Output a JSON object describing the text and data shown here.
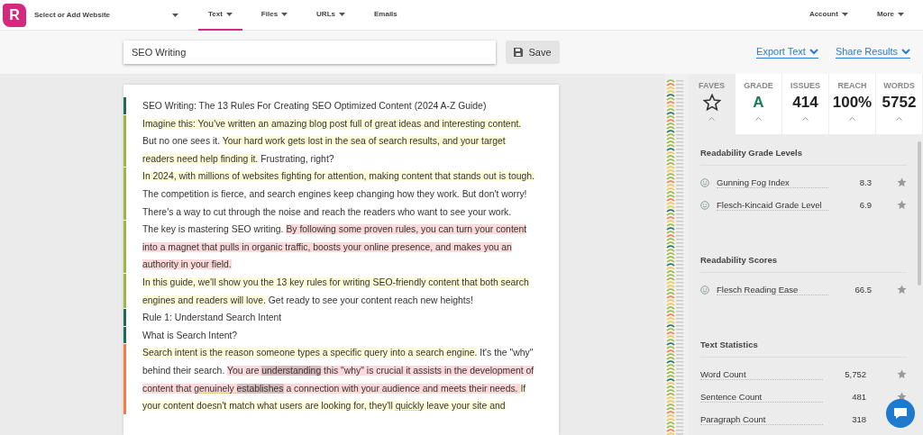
{
  "nav": {
    "site_select": "Select or Add Website",
    "items": [
      {
        "label": "Text",
        "selected": true,
        "dropdown": true
      },
      {
        "label": "Files",
        "selected": false,
        "dropdown": true
      },
      {
        "label": "URLs",
        "selected": false,
        "dropdown": true
      },
      {
        "label": "Emails",
        "selected": false,
        "dropdown": false
      }
    ],
    "right_items": [
      {
        "label": "Account"
      },
      {
        "label": "More"
      }
    ],
    "logo": "R"
  },
  "toolbar": {
    "title_value": "SEO Writing",
    "save": "Save",
    "links": [
      "Export Text",
      "Share Results"
    ]
  },
  "document": {
    "paragraphs": [
      {
        "color": "#1e6b5c",
        "segments": [
          {
            "text": "SEO Writing: The 13 Rules For Creating SEO Optimized Content (2024 A-Z Guide)",
            "hard": false,
            "very_hard": false
          }
        ]
      },
      {
        "color": "#9db83e",
        "segments": [
          {
            "text": "Imagine this: You've written an amazing blog post full of great ideas and interesting content.",
            "hard": true,
            "very_hard": false
          },
          {
            "text": " But no one sees it. ",
            "hard": false,
            "very_hard": false
          },
          {
            "text": "Your hard work gets lost in the sea of search results, and your target readers need help finding it.",
            "hard": true,
            "very_hard": false
          },
          {
            "text": " Frustrating, right?",
            "hard": false,
            "very_hard": false
          }
        ]
      },
      {
        "color": "#9db83e",
        "segments": [
          {
            "text": "In 2024, with millions of websites fighting for attention, making content that stands out is tough.",
            "hard": true,
            "very_hard": false
          },
          {
            "text": " The competition is fierce, and search engines keep changing how they work. But don't worry! There's a way to cut through the noise and reach the readers who want to see your work.",
            "hard": false,
            "very_hard": false
          }
        ]
      },
      {
        "color": "#9db83e",
        "segments": [
          {
            "text": "The key is mastering SEO writing. ",
            "hard": false,
            "very_hard": false
          },
          {
            "text": "By following some proven rules, you can turn your content into a magnet that pulls in organic traffic, boosts your online presence, and makes you an authority in your field.",
            "hard": false,
            "very_hard": true
          }
        ]
      },
      {
        "color": "#9db83e",
        "segments": [
          {
            "text": "In this guide, we'll show you the 13 key rules for writing SEO-friendly content that both search engines and readers will love.",
            "hard": true,
            "very_hard": false
          },
          {
            "text": " Get ready to see your content reach new heights!",
            "hard": false,
            "very_hard": false
          }
        ]
      },
      {
        "color": "#1e6b5c",
        "segments": [
          {
            "text": "Rule 1: Understand Search Intent",
            "hard": false,
            "very_hard": false
          }
        ]
      },
      {
        "color": "#1e6b5c",
        "segments": [
          {
            "text": "What is Search Intent?",
            "hard": false,
            "very_hard": false
          }
        ]
      },
      {
        "color": "#f47c48",
        "segments": [
          {
            "text": "Search intent is the reason someone types a specific query into a search engine.",
            "hard": true,
            "very_hard": false
          },
          {
            "text": " It's the \"why\" behind their search. ",
            "hard": false,
            "very_hard": false
          },
          {
            "text": "You are ",
            "hard": false,
            "very_hard": true
          },
          {
            "text": "understanding",
            "complex": true
          },
          {
            "text": " this \"why\" is crucial it assists in the development of content that ",
            "hard": false,
            "very_hard": true
          },
          {
            "text": "genuinely ",
            "adverb": true
          },
          {
            "text": "establishes",
            "complex": true
          },
          {
            "text": " a connection with your audience and meets their needs. ",
            "hard": false,
            "very_hard": true
          },
          {
            "text": "If your content doesn't match what users are looking for, they'll ",
            "hard": true,
            "very_hard": false
          },
          {
            "text": "quickly",
            "adverb": true
          },
          {
            "text": " leave your site and",
            "hard": true,
            "very_hard": false
          }
        ]
      }
    ]
  },
  "score_tabs": [
    {
      "label": "FAVES",
      "kind": "star",
      "selected": true
    },
    {
      "label": "GRADE",
      "kind": "grade",
      "value": "A",
      "selected": false
    },
    {
      "label": "ISSUES",
      "kind": "number",
      "value": "414",
      "selected": false
    },
    {
      "label": "REACH",
      "kind": "number",
      "value": "100%",
      "selected": false
    },
    {
      "label": "WORDS",
      "kind": "number",
      "value": "5752",
      "selected": false
    }
  ],
  "sections": [
    {
      "title": "Readability Grade Levels",
      "rows": [
        {
          "label": "Gunning Fog Index",
          "value": "8.3",
          "smiley": true
        },
        {
          "label": "Flesch-Kincaid Grade Level",
          "value": "6.9",
          "smiley": true
        }
      ]
    },
    {
      "title": "Readability Scores",
      "rows": [
        {
          "label": "Flesch Reading Ease",
          "value": "66.5",
          "smiley": true
        }
      ]
    },
    {
      "title": "Text Statistics",
      "rows": [
        {
          "label": "Word Count",
          "value": "5,752",
          "smiley": false
        },
        {
          "label": "Sentence Count",
          "value": "481",
          "smiley": false
        },
        {
          "label": "Paragraph Count",
          "value": "318",
          "smiley": false
        }
      ]
    }
  ]
}
